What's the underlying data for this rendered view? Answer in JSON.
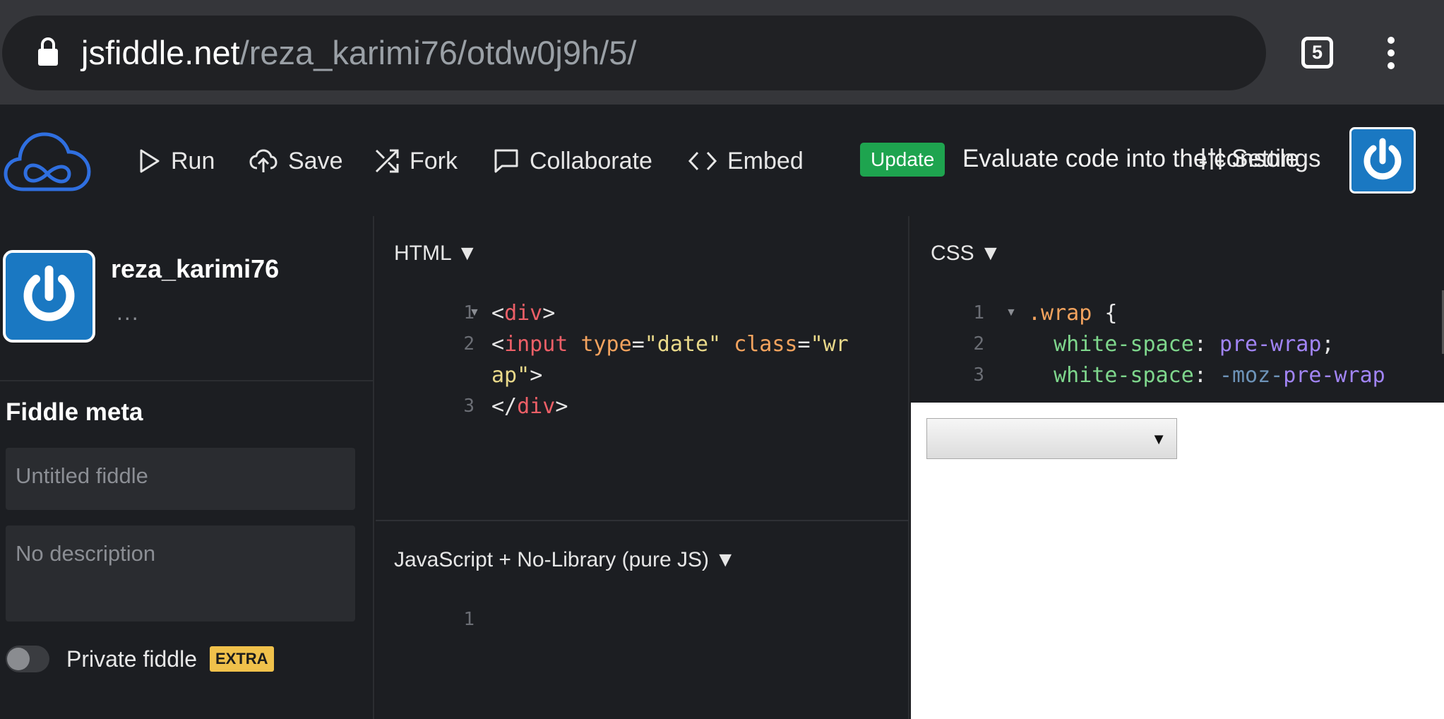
{
  "browser": {
    "url_host": "jsfiddle.net",
    "url_path": "/reza_karimi76/otdw0j9h/5/",
    "tab_count": "5"
  },
  "toolbar": {
    "run_label": "Run",
    "save_label": "Save",
    "fork_label": "Fork",
    "collaborate_label": "Collaborate",
    "embed_label": "Embed",
    "update_badge": "Update",
    "evaluate_text": "Evaluate code into the console",
    "settings_label": "Settings"
  },
  "sidebar": {
    "username": "reza_karimi76",
    "more": "...",
    "meta_title": "Fiddle meta",
    "title_placeholder": "Untitled fiddle",
    "description_placeholder": "No description",
    "private_label": "Private fiddle",
    "extra_badge": "EXTRA"
  },
  "panels": {
    "html_title": "HTML",
    "css_title": "CSS",
    "js_title": "JavaScript + No-Library (pure JS)",
    "dropdown_glyph": "▼"
  },
  "html_code": {
    "line_numbers": [
      "1",
      "2",
      "3"
    ],
    "l1_open": "<",
    "l1_tag": "div",
    "l1_close": ">",
    "l2_open": "<",
    "l2_tag": "input",
    "l2_attr1": "type",
    "l2_eq1": "=",
    "l2_str1": "\"date\"",
    "l2_attr2": "class",
    "l2_eq2": "=",
    "l2_str2a": "\"wr",
    "l2_str2b": "ap\"",
    "l2_close": ">",
    "l3_open": "</",
    "l3_tag": "div",
    "l3_close": ">"
  },
  "css_code": {
    "line_numbers": [
      "1",
      "2",
      "3"
    ],
    "selector": ".wrap",
    "brace": "{",
    "prop1": "white-space",
    "colon": ":",
    "val1": "pre-wrap",
    "semi": ";",
    "prop2": "white-space",
    "vendor": "-moz-",
    "val2": "pre-wrap"
  },
  "js_code": {
    "line_numbers": [
      "1"
    ]
  },
  "result": {
    "date_arrow": "▼"
  },
  "colors": {
    "update_green": "#1ea44f",
    "extra_yellow": "#f0c14b",
    "logo_blue": "#2f6fe0",
    "avatar_blue": "#1a78c2"
  }
}
